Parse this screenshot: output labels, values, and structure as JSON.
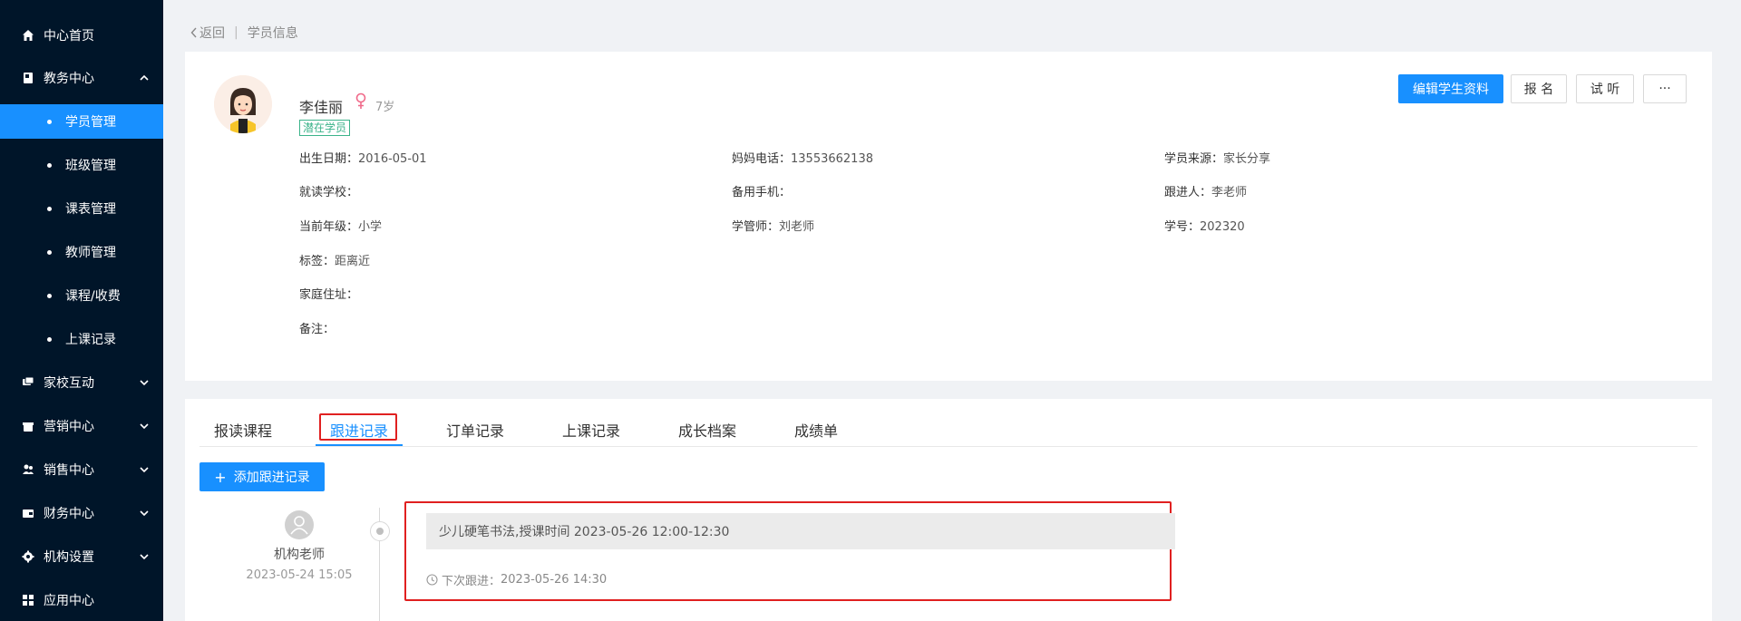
{
  "sidebar": {
    "items": [
      {
        "label": "中心首页",
        "icon": "home-icon"
      },
      {
        "label": "教务中心",
        "icon": "book-icon",
        "expanded": true,
        "children": [
          {
            "label": "学员管理",
            "active": true
          },
          {
            "label": "班级管理"
          },
          {
            "label": "课表管理"
          },
          {
            "label": "教师管理"
          },
          {
            "label": "课程/收费"
          },
          {
            "label": "上课记录"
          }
        ]
      },
      {
        "label": "家校互动",
        "icon": "chat-icon"
      },
      {
        "label": "营销中心",
        "icon": "gift-icon"
      },
      {
        "label": "销售中心",
        "icon": "users-icon"
      },
      {
        "label": "财务中心",
        "icon": "wallet-icon"
      },
      {
        "label": "机构设置",
        "icon": "gear-icon"
      },
      {
        "label": "应用中心",
        "icon": "grid-icon"
      }
    ]
  },
  "breadcrumb": {
    "back": "返回",
    "separator": "|",
    "current": "学员信息"
  },
  "student": {
    "name": "李佳丽",
    "gender_icon": "female-icon",
    "age": "7岁",
    "tag": "潜在学员",
    "info": {
      "birth_label": "出生日期：",
      "birth": "2016-05-01",
      "mom_phone_label": "妈妈电话：",
      "mom_phone": "13553662138",
      "source_label": "学员来源：",
      "source": "家长分享",
      "school_label": "就读学校：",
      "school": "",
      "backup_phone_label": "备用手机：",
      "backup_phone": "",
      "follower_label": "跟进人：",
      "follower": "李老师",
      "grade_label": "当前年级：",
      "grade": "小学",
      "manager_label": "学管师：",
      "manager": "刘老师",
      "student_no_label": "学号：",
      "student_no": "202320",
      "tags_label": "标签：",
      "tags": "距离近",
      "address_label": "家庭住址：",
      "address": "",
      "remark_label": "备注：",
      "remark": ""
    }
  },
  "actions": {
    "edit": "编辑学生资料",
    "enroll": "报 名",
    "trial": "试 听",
    "more": "···"
  },
  "tabs": [
    {
      "label": "报读课程"
    },
    {
      "label": "跟进记录",
      "active": true
    },
    {
      "label": "订单记录"
    },
    {
      "label": "上课记录"
    },
    {
      "label": "成长档案"
    },
    {
      "label": "成绩单"
    }
  ],
  "follow": {
    "add_button": "添加跟进记录",
    "records": [
      {
        "author": "机构老师",
        "time": "2023-05-24 15:05",
        "content": "少儿硬笔书法,授课时间 2023-05-26 12:00-12:30",
        "next_label": "下次跟进：",
        "next_time": "2023-05-26 14:30"
      }
    ]
  },
  "colors": {
    "primary": "#1890ff",
    "sidebar_bg": "#001529",
    "highlight": "#e02020",
    "tag": "#3bb38a"
  }
}
